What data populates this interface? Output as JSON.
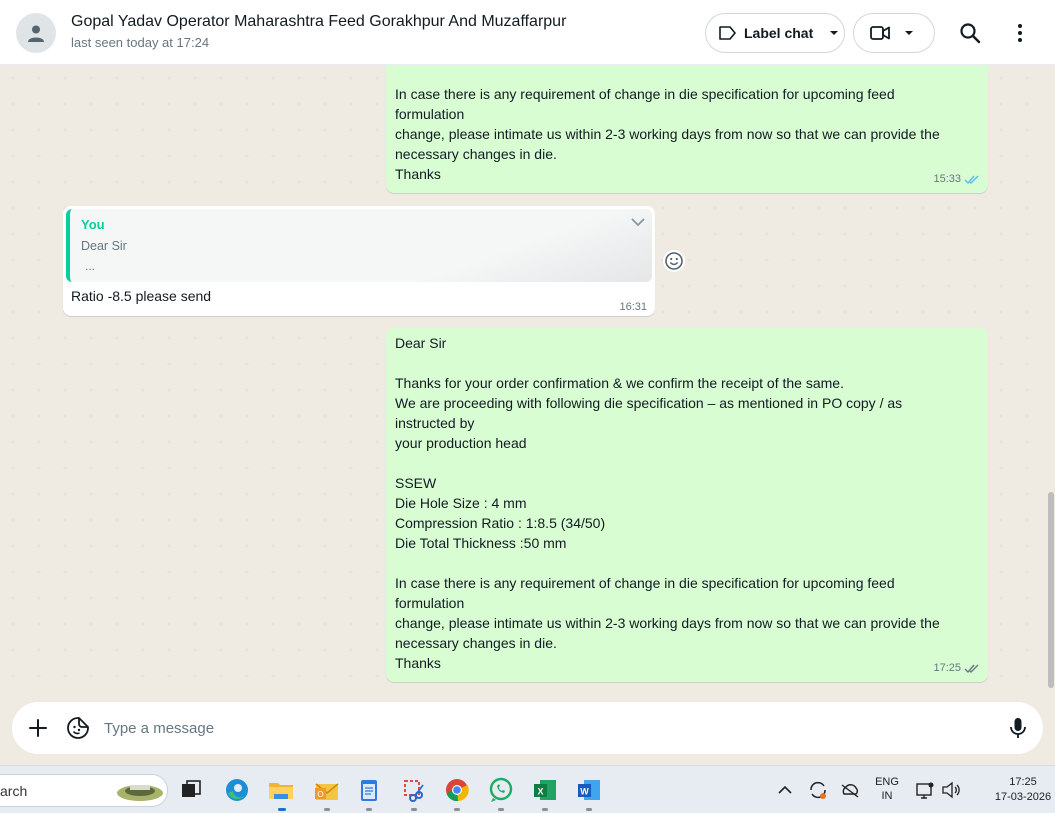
{
  "header": {
    "contact_name": "Gopal Yadav Operator Maharashtra Feed Gorakhpur And Muzaffarpur",
    "last_seen": "last seen today at 17:24",
    "label_chat": "Label chat"
  },
  "messages": {
    "first_out": {
      "lines": [
        "In case there is any requirement of change in die specification for upcoming feed",
        "formulation",
        "change, please intimate us within 2-3 working days from now so that we can provide the",
        "necessary changes in die.",
        "Thanks"
      ],
      "time": "15:33"
    },
    "incoming": {
      "quote_author": "You",
      "quote_text": "Dear Sir",
      "quote_more": "...",
      "text": "Ratio -8.5 please send",
      "time": "16:31"
    },
    "second_out": {
      "lines": [
        "Dear Sir",
        "",
        "Thanks for your order confirmation & we confirm the receipt of the same.",
        "We are proceeding with following die specification – as mentioned in PO copy / as",
        "instructed by",
        "your production head",
        "",
        "SSEW",
        "Die Hole Size : 4 mm",
        "Compression Ratio : 1:8.5 (34/50)",
        "Die Total Thickness :50 mm",
        "",
        "In case there is any requirement of change in die specification for upcoming feed",
        "formulation",
        "change, please intimate us within 2-3 working days from now so that we can provide the",
        "necessary changes in die.",
        "Thanks"
      ],
      "time": "17:25"
    }
  },
  "composer": {
    "placeholder": "Type a message"
  },
  "taskbar": {
    "search_text": "arch",
    "lang_top": "ENG",
    "lang_bottom": "IN",
    "time": "17:25",
    "date": "17-03-2026"
  }
}
